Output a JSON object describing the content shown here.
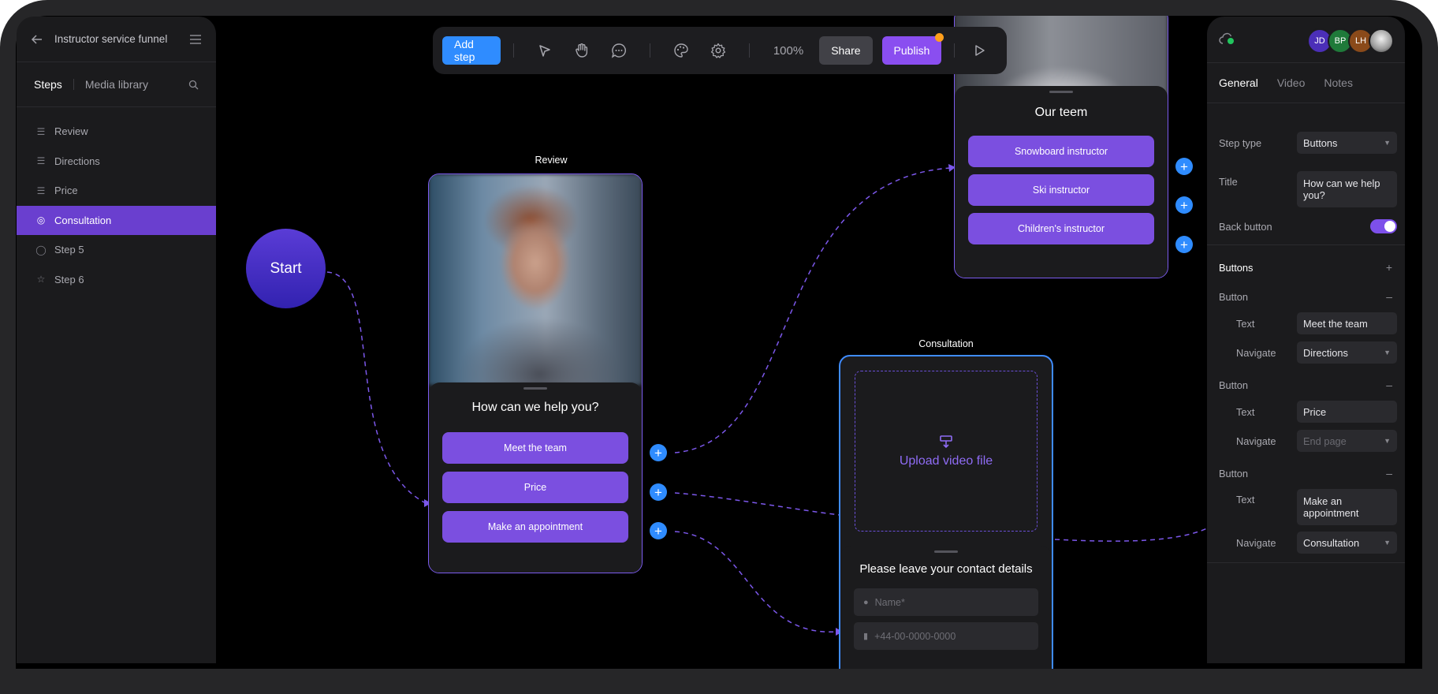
{
  "funnel": {
    "back_icon": "arrow-left-icon",
    "title": "Instructor service funnel",
    "menu_icon": "hamburger-menu-icon"
  },
  "left_tabs": {
    "steps": "Steps",
    "media": "Media library",
    "search_icon": "search-icon"
  },
  "steps": [
    {
      "label": "Review",
      "icon": "list-icon"
    },
    {
      "label": "Directions",
      "icon": "list-icon"
    },
    {
      "label": "Price",
      "icon": "list-icon"
    },
    {
      "label": "Consultation",
      "icon": "target-icon",
      "active": true
    },
    {
      "label": "Step 5",
      "icon": "user-icon"
    },
    {
      "label": "Step 6",
      "icon": "star-icon"
    }
  ],
  "toolbar": {
    "add_step": "Add step",
    "zoom": "100%",
    "share": "Share",
    "publish": "Publish",
    "tools": [
      "pointer-icon",
      "hand-icon",
      "comment-icon",
      "palette-icon",
      "gear-icon",
      "play-icon"
    ]
  },
  "start_node": "Start",
  "review_card": {
    "label": "Review",
    "question": "How can we help you?",
    "buttons": [
      "Meet the team",
      "Price",
      "Make an appointment"
    ]
  },
  "team_card": {
    "title": "Our teem",
    "buttons": [
      "Snowboard instructor",
      "Ski instructor",
      "Children's instructor"
    ]
  },
  "consultation_card": {
    "label": "Consultation",
    "upload": "Upload video file",
    "form_title": "Please leave your contact details",
    "name_placeholder": "Name*",
    "phone_placeholder": "+44-00-0000-0000"
  },
  "right_panel": {
    "cloud_icon": "cloud-sync-icon",
    "avatars": [
      {
        "initials": "JD",
        "color": "#4b2fb8"
      },
      {
        "initials": "BP",
        "color": "#1f7a3a"
      },
      {
        "initials": "LH",
        "color": "#8a4a1a"
      },
      {
        "initials": "",
        "color": "#d0d0d0"
      }
    ],
    "tabs": [
      "General",
      "Video",
      "Notes"
    ],
    "step_type_label": "Step type",
    "step_type_value": "Buttons",
    "title_label": "Title",
    "title_value": "How can we help you?",
    "back_button_label": "Back button",
    "back_button_on": true,
    "buttons_section": "Buttons",
    "buttons": [
      {
        "label": "Button",
        "text_label": "Text",
        "text": "Meet the team",
        "nav_label": "Navigate",
        "nav": "Directions"
      },
      {
        "label": "Button",
        "text_label": "Text",
        "text": "Price",
        "nav_label": "Navigate",
        "nav": "End page"
      },
      {
        "label": "Button",
        "text_label": "Text",
        "text": "Make an appointment",
        "nav_label": "Navigate",
        "nav": "Consultation"
      }
    ]
  }
}
